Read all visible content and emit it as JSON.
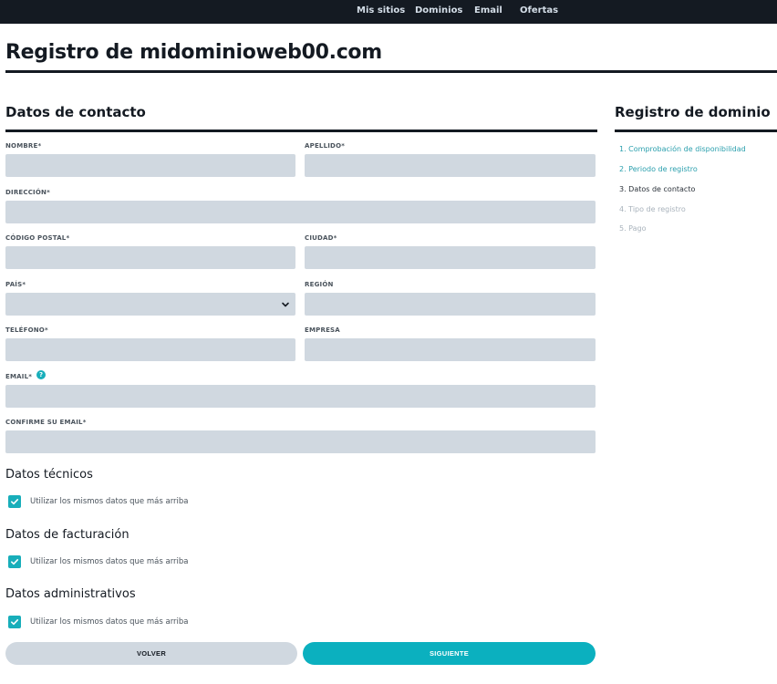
{
  "nav": {
    "items": [
      "Mis sitios",
      "Dominios",
      "Email",
      "Ofertas"
    ]
  },
  "page": {
    "title": "Registro de midominioweb00.com"
  },
  "form": {
    "section_title": "Datos de contacto",
    "required_mark": "*",
    "fields": {
      "nombre": {
        "label": "NOMBRE",
        "required": true,
        "value": ""
      },
      "apellido": {
        "label": "APELLIDO",
        "required": true,
        "value": ""
      },
      "direccion": {
        "label": "DIRECCIÓN",
        "required": true,
        "value": ""
      },
      "codigo_postal": {
        "label": "CÓDIGO POSTAL",
        "required": true,
        "value": ""
      },
      "ciudad": {
        "label": "CIUDAD",
        "required": true,
        "value": ""
      },
      "pais": {
        "label": "PAÍS",
        "required": true,
        "value": ""
      },
      "region": {
        "label": "REGIÓN",
        "required": false,
        "value": ""
      },
      "telefono": {
        "label": "TELÉFONO",
        "required": true,
        "value": ""
      },
      "empresa": {
        "label": "EMPRESA",
        "required": false,
        "value": ""
      },
      "email": {
        "label": "EMAIL",
        "required": true,
        "value": ""
      },
      "confirm_email": {
        "label": "CONFIRME SU EMAIL",
        "required": true,
        "value": ""
      }
    },
    "help_icon": "question-circle-icon",
    "select_icon": "chevron-down-icon"
  },
  "subsections": [
    {
      "title": "Datos técnicos",
      "checkbox_label": "Utilizar los mismos datos que más arriba",
      "checked": true
    },
    {
      "title": "Datos de facturación",
      "checkbox_label": "Utilizar los mismos datos que más arriba",
      "checked": true
    },
    {
      "title": "Datos administrativos",
      "checkbox_label": "Utilizar los mismos datos que más arriba",
      "checked": true
    }
  ],
  "buttons": {
    "back": "VOLVER",
    "next": "SIGUIENTE"
  },
  "sidebar": {
    "title": "Registro de dominio",
    "steps": [
      {
        "label": "1. Comprobación de disponibilidad",
        "state": "done"
      },
      {
        "label": "2. Periodo de registro",
        "state": "done"
      },
      {
        "label": "3. Datos de contacto",
        "state": "current"
      },
      {
        "label": "4. Tipo de registro",
        "state": "todo"
      },
      {
        "label": "5. Pago",
        "state": "todo"
      }
    ]
  },
  "colors": {
    "nav_bg": "#141a22",
    "accent": "#0bb0bf",
    "input_bg": "#d0d8e0",
    "step_done": "#2a9fad",
    "step_todo": "#a9b3bc"
  }
}
